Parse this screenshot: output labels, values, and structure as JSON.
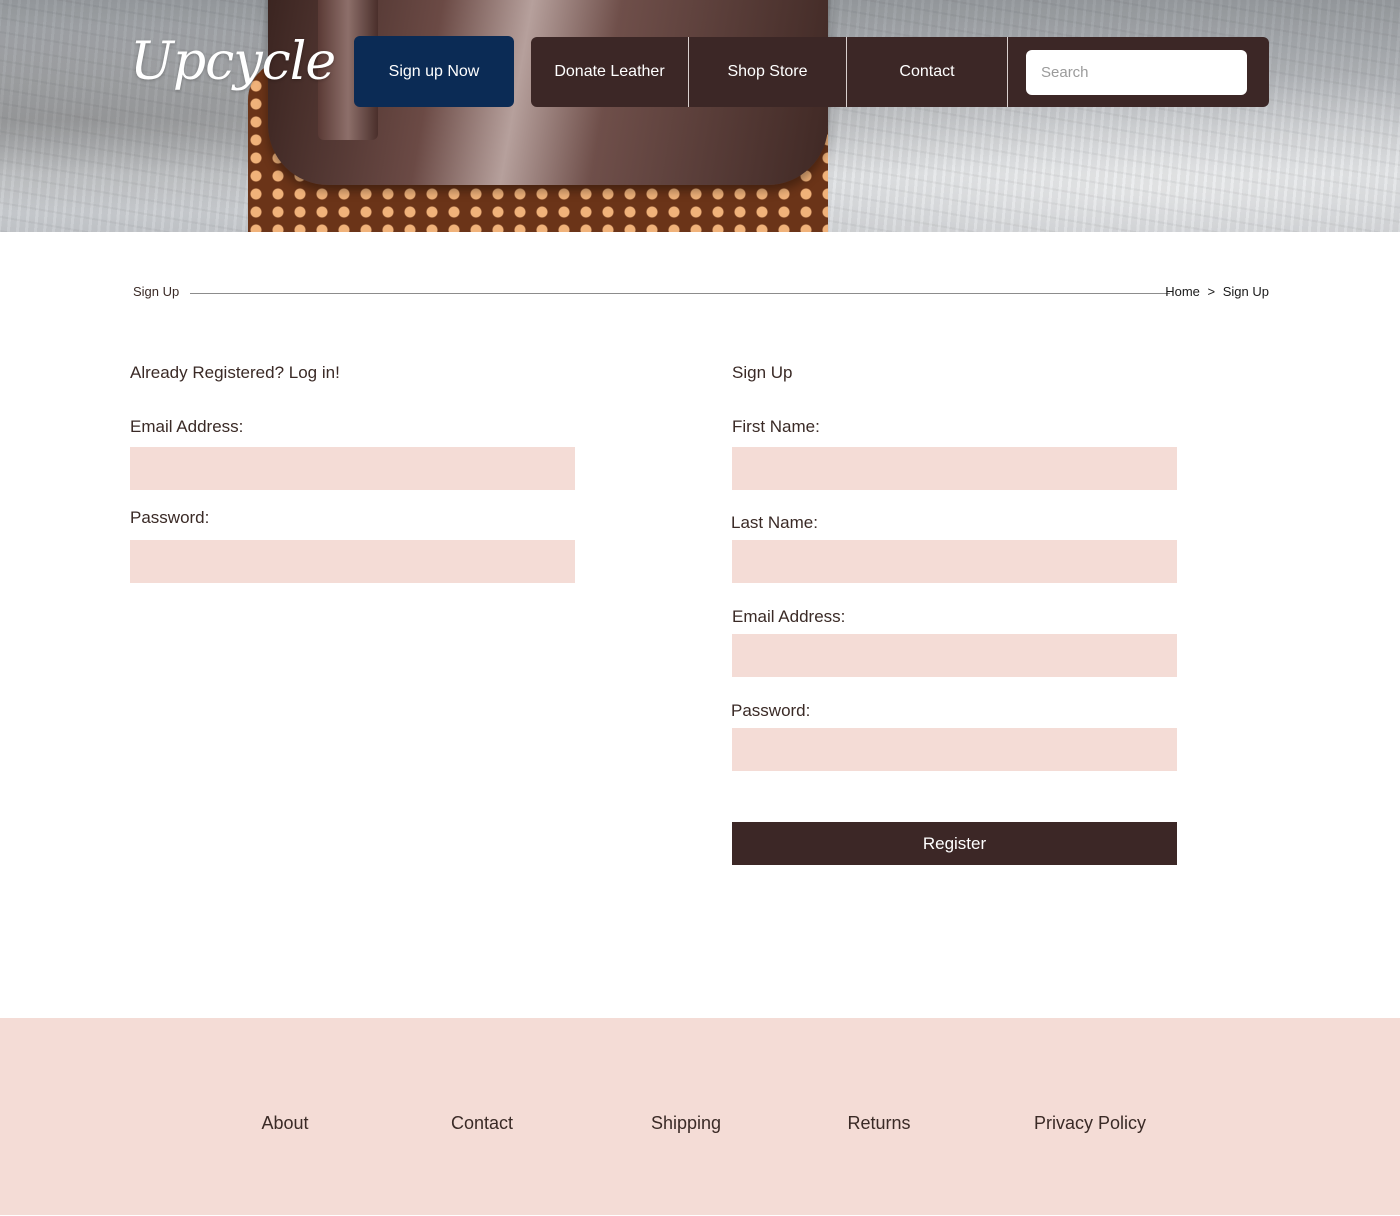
{
  "header": {
    "logo": "Upcycle",
    "signup_button": "Sign up Now",
    "nav": [
      "Donate Leather",
      "Shop Store",
      "Contact"
    ],
    "search_placeholder": "Search"
  },
  "breadcrumb": {
    "title": "Sign Up",
    "path": [
      "Home",
      "Sign Up"
    ],
    "separator": ">"
  },
  "login": {
    "heading": "Already Registered? Log in!",
    "email_label": "Email Address:",
    "password_label": "Password:"
  },
  "signup": {
    "heading": "Sign Up",
    "first_name_label": "First Name:",
    "last_name_label": "Last Name:",
    "email_label": "Email Address:",
    "password_label": "Password:",
    "register_button": "Register"
  },
  "footer": {
    "links": [
      "About",
      "Contact",
      "Shipping",
      "Returns",
      "Privacy Policy"
    ]
  },
  "colors": {
    "nav_background": "#3c2726",
    "signup_button": "#0b2b55",
    "field_background": "#f4dcd6",
    "footer_background": "#f4dcd6"
  }
}
